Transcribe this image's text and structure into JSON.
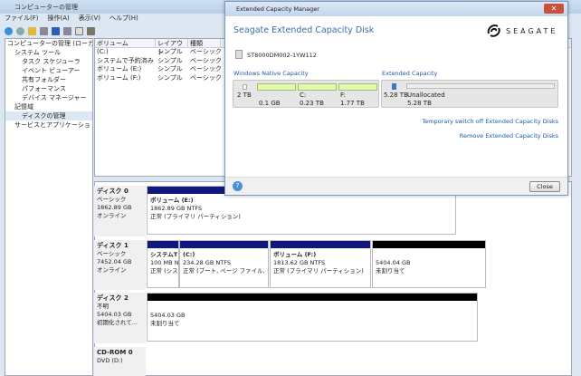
{
  "mmc": {
    "title": "コンピューターの管理",
    "menu": [
      "ファイル(F)",
      "操作(A)",
      "表示(V)",
      "ヘルプ(H)"
    ],
    "tree": [
      {
        "label": "コンピューターの管理 (ローカ",
        "indent": 0
      },
      {
        "label": "システム ツール",
        "indent": 1
      },
      {
        "label": "タスク スケジューラ",
        "indent": 2
      },
      {
        "label": "イベント ビューアー",
        "indent": 2
      },
      {
        "label": "共有フォルダー",
        "indent": 2
      },
      {
        "label": "パフォーマンス",
        "indent": 2
      },
      {
        "label": "デバイス マネージャー",
        "indent": 2
      },
      {
        "label": "記憶域",
        "indent": 1
      },
      {
        "label": "ディスクの管理",
        "indent": 2
      },
      {
        "label": "サービスとアプリケーショ",
        "indent": 1
      }
    ],
    "columns": [
      "ボリューム",
      "レイアウト",
      "種類"
    ],
    "rows": [
      [
        "(C:)",
        "シンプル",
        "ベーシック"
      ],
      [
        "システムで予約済み",
        "シンプル",
        "ベーシック"
      ],
      [
        "ボリューム (E:)",
        "シンプル",
        "ベーシック"
      ],
      [
        "ボリューム (F:)",
        "シンプル",
        "ベーシック"
      ]
    ],
    "disks": [
      {
        "name": "ディスク 0",
        "type": "ベーシック",
        "size": "1862.89 GB",
        "status": "オンライン",
        "parts": [
          {
            "name": "ボリューム (E:)",
            "size": "1862.89 GB NTFS",
            "status": "正常 (プライマリ パーティション)",
            "unalloc": false
          }
        ]
      },
      {
        "name": "ディスク 1",
        "type": "ベーシック",
        "size": "7452.04 GB",
        "status": "オンライン",
        "parts": [
          {
            "name": "システムT",
            "size": "100 MB N",
            "status": "正常 (シス",
            "unalloc": false
          },
          {
            "name": "(C:)",
            "size": "234.28 GB NTFS",
            "status": "正常 (ブート, ページ ファイル, ク",
            "unalloc": false
          },
          {
            "name": "ボリューム (F:)",
            "size": "1813.62 GB NTFS",
            "status": "正常 (プライマリ パーティション)",
            "unalloc": false
          },
          {
            "name": "",
            "size": "5404.04 GB",
            "status": "未割り当て",
            "unalloc": true
          }
        ]
      },
      {
        "name": "ディスク 2",
        "type": "不明",
        "size": "5404.03 GB",
        "status": "初期化されて...",
        "parts": [
          {
            "name": "",
            "size": "5404.03 GB",
            "status": "未割り当て",
            "unalloc": true
          }
        ]
      }
    ],
    "cdrom": {
      "name": "CD-ROM 0",
      "type": "DVD (D:)"
    }
  },
  "dialog": {
    "title": "Extended Capacity Manager",
    "heading": "Seagate Extended Capacity Disk",
    "brand": "SEAGATE",
    "model": "ST8000DM002-1YW112",
    "native": {
      "label": "Windows Native Capacity",
      "total": "2 TB",
      "parts": [
        {
          "name": "",
          "size": "0.1 GB"
        },
        {
          "name": "C:",
          "size": "0.23 TB"
        },
        {
          "name": "F:",
          "size": "1.77 TB"
        }
      ]
    },
    "extended": {
      "label": "Extended Capacity",
      "total": "5.28 TB",
      "name": "Unallocated",
      "size": "5.28 TB"
    },
    "links": [
      "Temporary switch off Extended Capacity Disks",
      "Remove Extended Capacity Disks"
    ],
    "close": "Close"
  }
}
